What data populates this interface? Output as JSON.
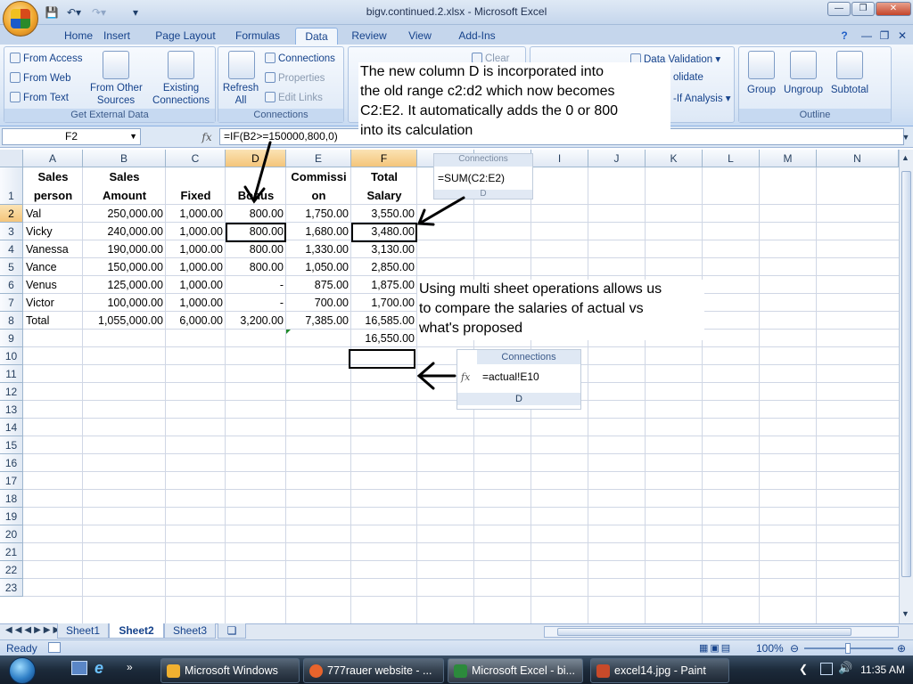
{
  "window": {
    "title": "bigv.continued.2.xlsx - Microsoft Excel"
  },
  "ribbon_tabs": [
    "Home",
    "Insert",
    "Page Layout",
    "Formulas",
    "Data",
    "Review",
    "View",
    "Add-Ins"
  ],
  "ribbon": {
    "get_external": {
      "access": "From Access",
      "web": "From Web",
      "text": "From Text",
      "other_1": "From Other",
      "other_2": "Sources",
      "existing_1": "Existing",
      "existing_2": "Connections",
      "label": "Get External Data"
    },
    "connections": {
      "refresh_1": "Refresh",
      "refresh_2": "All",
      "connections": "Connections",
      "properties": "Properties",
      "edit_links": "Edit Links",
      "label": "Connections"
    },
    "sort": {
      "clear": "Clear"
    },
    "data_tools": {
      "validation": "Data Validation",
      "consolidate": "olidate",
      "whatif": "-If Analysis"
    },
    "outline": {
      "group": "Group",
      "ungroup": "Ungroup",
      "subtotal": "Subtotal",
      "label": "Outline"
    }
  },
  "formula_bar": {
    "name_box": "F2",
    "fx": "fx",
    "formula": "=IF(B2>=150000,800,0)"
  },
  "columns": [
    "A",
    "B",
    "C",
    "D",
    "E",
    "F",
    "G",
    "H",
    "I",
    "J",
    "K",
    "L",
    "M",
    "N"
  ],
  "rows": [
    "1",
    "2",
    "3",
    "4",
    "5",
    "6",
    "7",
    "8",
    "9",
    "10",
    "11",
    "12",
    "13",
    "14",
    "15",
    "16",
    "17",
    "18",
    "19",
    "20",
    "21",
    "22",
    "23"
  ],
  "headers": {
    "a": [
      "Sales",
      "person"
    ],
    "b": [
      "Sales",
      "Amount"
    ],
    "c": "Fixed",
    "d": "Bonus",
    "e": [
      "Commissi",
      "on"
    ],
    "f": [
      "Total",
      "Salary"
    ]
  },
  "table": [
    [
      "Val",
      "250,000.00",
      "1,000.00",
      "800.00",
      "1,750.00",
      "3,550.00"
    ],
    [
      "Vicky",
      "240,000.00",
      "1,000.00",
      "800.00",
      "1,680.00",
      "3,480.00"
    ],
    [
      "Vanessa",
      "190,000.00",
      "1,000.00",
      "800.00",
      "1,330.00",
      "3,130.00"
    ],
    [
      "Vance",
      "150,000.00",
      "1,000.00",
      "800.00",
      "1,050.00",
      "2,850.00"
    ],
    [
      "Venus",
      "125,000.00",
      "1,000.00",
      "-",
      "875.00",
      "1,875.00"
    ],
    [
      "Victor",
      "100,000.00",
      "1,000.00",
      "-",
      "700.00",
      "1,700.00"
    ],
    [
      "Total",
      "1,055,000.00",
      "6,000.00",
      "3,200.00",
      "7,385.00",
      "16,585.00"
    ]
  ],
  "f9_value": "16,550.00",
  "callouts": {
    "top": [
      "The new column D is incorporated into",
      "the old range c2:d2 which now becomes",
      "C2:E2. It automatically adds the 0 or 800",
      "into its calculation"
    ],
    "mid": [
      "Using multi sheet operations allows us",
      "to compare the salaries of actual vs",
      "what's proposed"
    ]
  },
  "snippets": {
    "sum": {
      "formula": "=SUM(C2:E2)",
      "hdr": "Connections",
      "col": "D"
    },
    "actual": {
      "formula": "=actual!E10",
      "hdr": "Connections",
      "col": "D",
      "fx": "fx"
    }
  },
  "sheet_tabs": [
    "Sheet1",
    "Sheet2",
    "Sheet3"
  ],
  "status": {
    "ready": "Ready",
    "zoom": "100%"
  },
  "taskbar": {
    "items": [
      "Microsoft Windows",
      "777rauer website - ...",
      "Microsoft Excel - bi...",
      "excel14.jpg - Paint"
    ],
    "clock": "11:35 AM"
  }
}
